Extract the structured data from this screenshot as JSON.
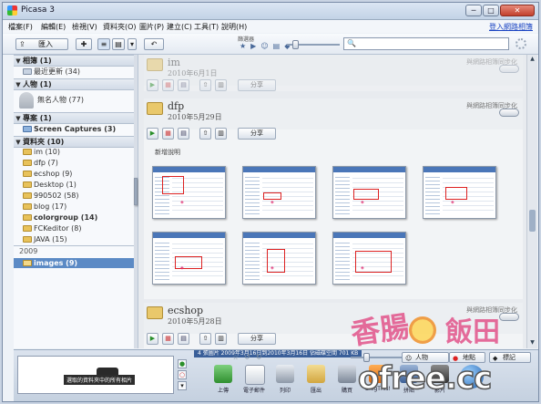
{
  "window": {
    "title": "Picasa 3",
    "buttons": {
      "minimize": "─",
      "maximize": "□",
      "close": "✕"
    }
  },
  "menu": {
    "items": [
      "檔案(F)",
      "編輯(E)",
      "檢視(V)",
      "資料夾(O)",
      "圖片(P)",
      "建立(C)",
      "工具(T)",
      "說明(H)"
    ],
    "login": "登入網路相簿"
  },
  "toolbar": {
    "import_label": "匯入",
    "filter_label": "篩選器",
    "search_value": "",
    "view_buttons": [
      "≡",
      "▤",
      "▾"
    ]
  },
  "sidebar": {
    "sections": {
      "albums": "相簿 (1)",
      "people": "人物 (1)",
      "projects": "專案 (1)",
      "folders": "資料夾 (10)"
    },
    "recent": "最近更新 (34)",
    "unnamed_person": "無名人物 (77)",
    "screen_captures": "Screen Captures (3)",
    "folders": [
      {
        "label": "im (10)",
        "bold": false
      },
      {
        "label": "dfp (7)",
        "bold": false
      },
      {
        "label": "ecshop (9)",
        "bold": false
      },
      {
        "label": "Desktop (1)",
        "bold": false
      },
      {
        "label": "990502 (58)",
        "bold": false
      },
      {
        "label": "blog (17)",
        "bold": false
      },
      {
        "label": "colorgroup (14)",
        "bold": true
      },
      {
        "label": "FCKeditor (8)",
        "bold": false
      },
      {
        "label": "JAVA (15)",
        "bold": false
      }
    ],
    "year": "2009",
    "selected": "images (9)"
  },
  "albums": [
    {
      "name": "im",
      "date": "2010年6月1日",
      "sync": "與網路相簿同步化",
      "share": "分享"
    },
    {
      "name": "dfp",
      "date": "2010年5月29日",
      "sync": "與網路相簿同步化",
      "share": "分享",
      "description": "新增說明"
    },
    {
      "name": "ecshop",
      "date": "2010年5月28日",
      "sync": "與網路相簿同步化",
      "share": "分享"
    }
  ],
  "status": "4 張圖片  2009年3月16日到2010年3月16日  佔磁碟空間 701 KB",
  "bottom": {
    "tray_label": "選取的資料夾中的所有相片",
    "chips": {
      "people": "人物",
      "map": "地點",
      "tags": "標記"
    },
    "actions": [
      "上傳",
      "電子郵件",
      "列印",
      "匯出",
      "購買",
      "BlogThis!",
      "拼貼",
      "影片"
    ]
  },
  "watermark": {
    "line1": "香腸",
    "line2": "飯田",
    "site": "ofree.cc"
  },
  "colors": {
    "accent": "#5b8ac5",
    "status_bg": "#3a5f99",
    "watermark": "#e03e7c"
  }
}
